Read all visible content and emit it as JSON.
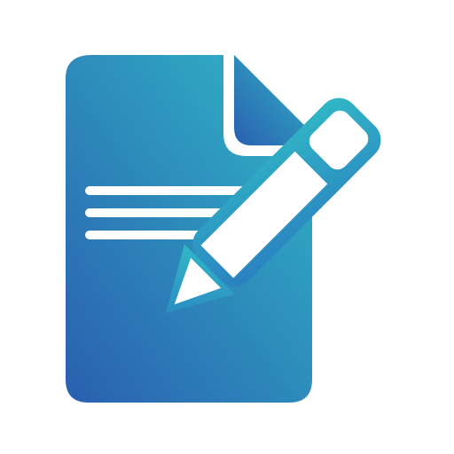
{
  "icon": {
    "name": "document-edit-icon",
    "colors": {
      "background": "#ffffff",
      "gradient_start": "#2a5fb0",
      "gradient_end": "#31b8c6",
      "foreground": "#ffffff"
    }
  }
}
